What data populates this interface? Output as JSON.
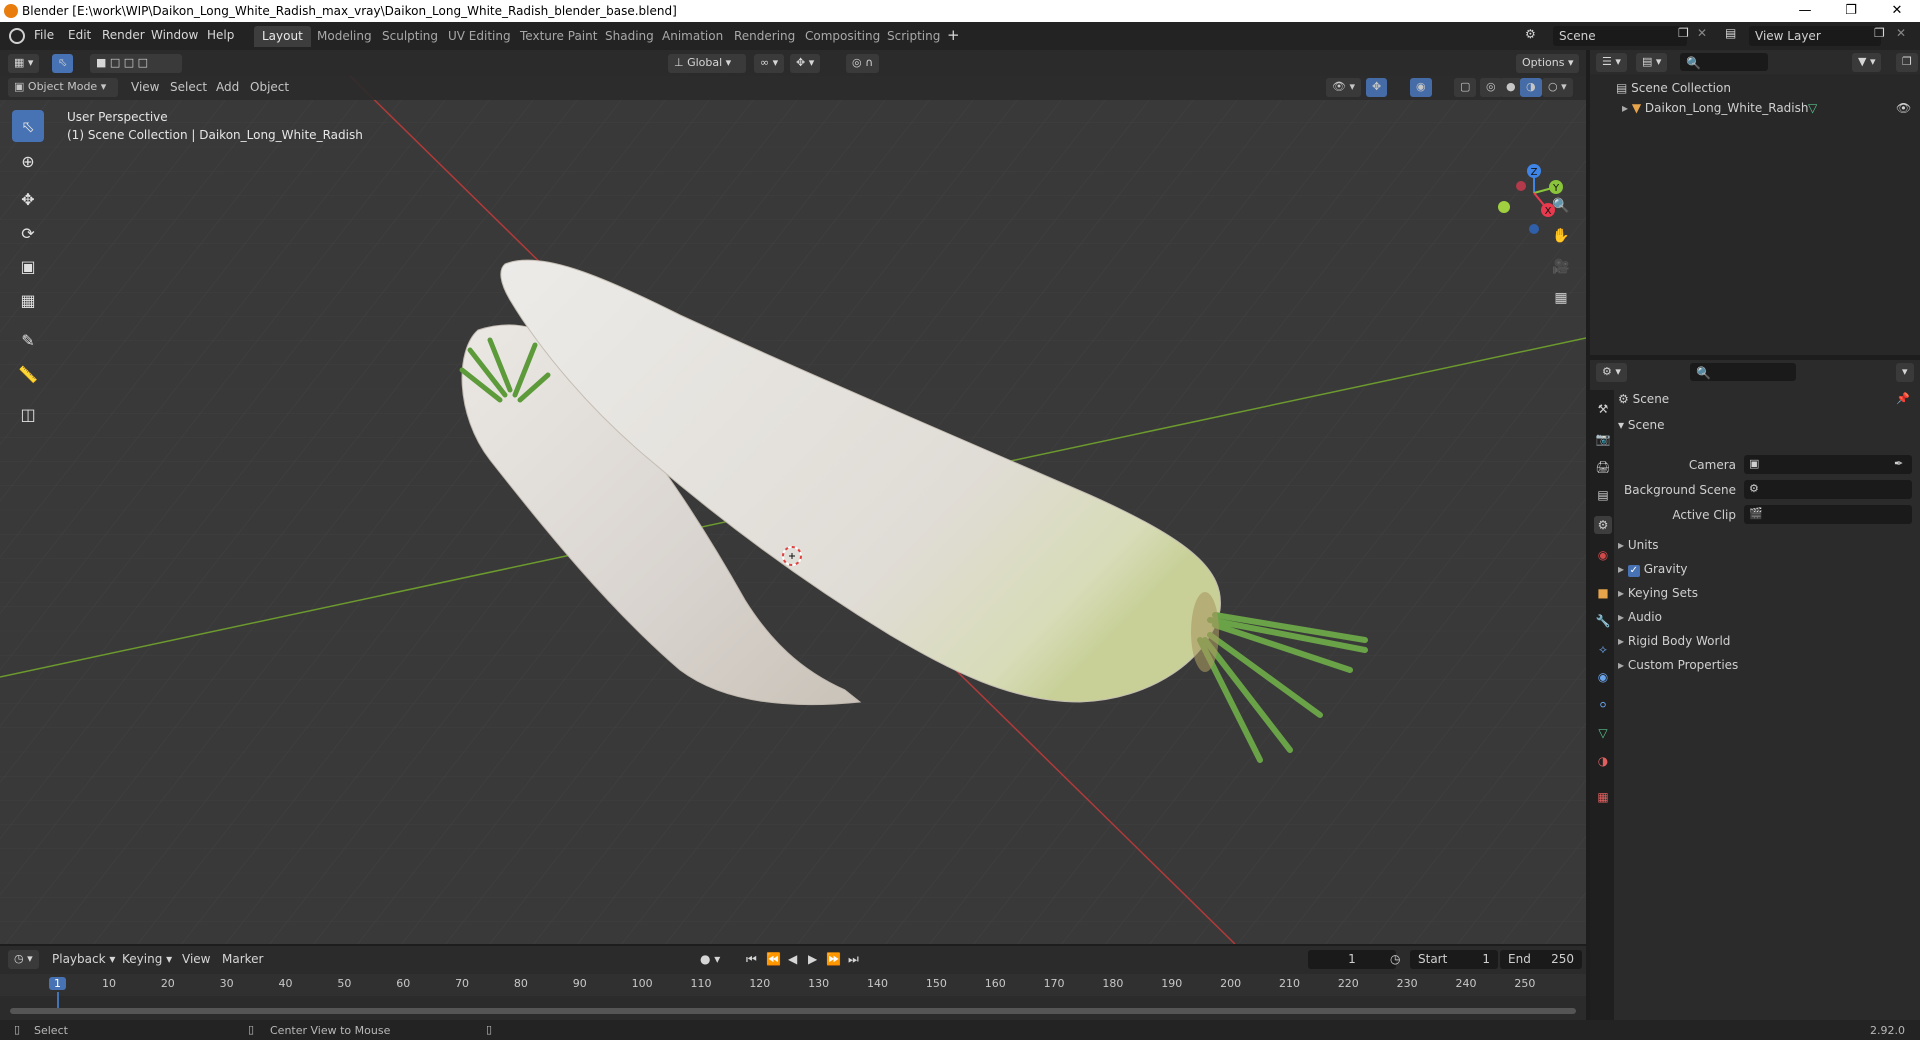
{
  "window": {
    "title": "Blender [E:\\work\\WIP\\Daikon_Long_White_Radish_max_vray\\Daikon_Long_White_Radish_blender_base.blend]"
  },
  "menu": [
    "File",
    "Edit",
    "Render",
    "Window",
    "Help"
  ],
  "workspaces": [
    "Layout",
    "Modeling",
    "Sculpting",
    "UV Editing",
    "Texture Paint",
    "Shading",
    "Animation",
    "Rendering",
    "Compositing",
    "Scripting"
  ],
  "active_workspace": "Layout",
  "scene_field": "Scene",
  "view_layer_field": "View Layer",
  "viewport": {
    "mode": "Object Mode",
    "menus": [
      "View",
      "Select",
      "Add",
      "Object"
    ],
    "transform_orientation": "Global",
    "options_label": "Options",
    "perspective_label": "User Perspective",
    "collection_label": "(1) Scene Collection | Daikon_Long_White_Radish",
    "gizmo_axes": [
      "X",
      "Y",
      "Z"
    ]
  },
  "outliner": {
    "root": "Scene Collection",
    "items": [
      {
        "name": "Daikon_Long_White_Radish"
      }
    ]
  },
  "properties": {
    "header": "Scene",
    "section": "Scene",
    "fields": [
      {
        "label": "Camera",
        "value": ""
      },
      {
        "label": "Background Scene",
        "value": ""
      },
      {
        "label": "Active Clip",
        "value": ""
      }
    ],
    "panels": [
      "Units",
      "Gravity",
      "Keying Sets",
      "Audio",
      "Rigid Body World",
      "Custom Properties"
    ],
    "gravity_checked": true
  },
  "timeline": {
    "menus": [
      "Playback",
      "Keying",
      "View",
      "Marker"
    ],
    "current_frame": "1",
    "start_label": "Start",
    "start": "1",
    "end_label": "End",
    "end": "250",
    "ruler": [
      "1",
      "10",
      "20",
      "30",
      "40",
      "50",
      "60",
      "70",
      "80",
      "90",
      "100",
      "110",
      "120",
      "130",
      "140",
      "150",
      "160",
      "170",
      "180",
      "190",
      "200",
      "210",
      "220",
      "230",
      "240",
      "250"
    ]
  },
  "statusbar": {
    "left": "Select",
    "middle": "Center View to Mouse",
    "version": "2.92.0"
  },
  "colors": {
    "accent": "#4772b3",
    "x_axis": "#e8394f",
    "y_axis": "#8ac43a",
    "z_axis": "#3f85e8"
  }
}
